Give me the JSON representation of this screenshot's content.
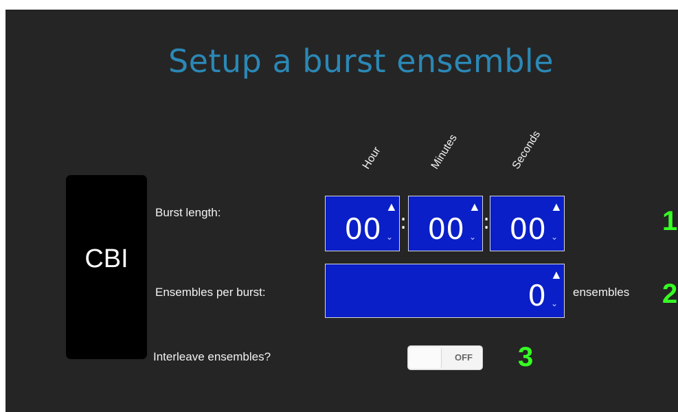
{
  "title": "Setup a burst ensemble",
  "logo_text": "CBI",
  "columns": {
    "hour": "Hour",
    "minutes": "Minutes",
    "seconds": "Seconds"
  },
  "burst_length": {
    "label": "Burst length:",
    "hour": "00",
    "minutes": "00",
    "seconds": "00",
    "separator": ":"
  },
  "ensembles_per_burst": {
    "label": "Ensembles per burst:",
    "value": "0",
    "unit": "ensembles"
  },
  "interleave": {
    "label": "Interleave ensembles?",
    "state": "OFF"
  },
  "step_numbers": [
    "1",
    "2",
    "3"
  ],
  "spinner_icons": {
    "up": "▲",
    "down": "⌄"
  },
  "colors": {
    "title": "#2b88b6",
    "spinner_bg": "#0a1fc7",
    "step": "#35ff23",
    "panel": "#252525"
  }
}
